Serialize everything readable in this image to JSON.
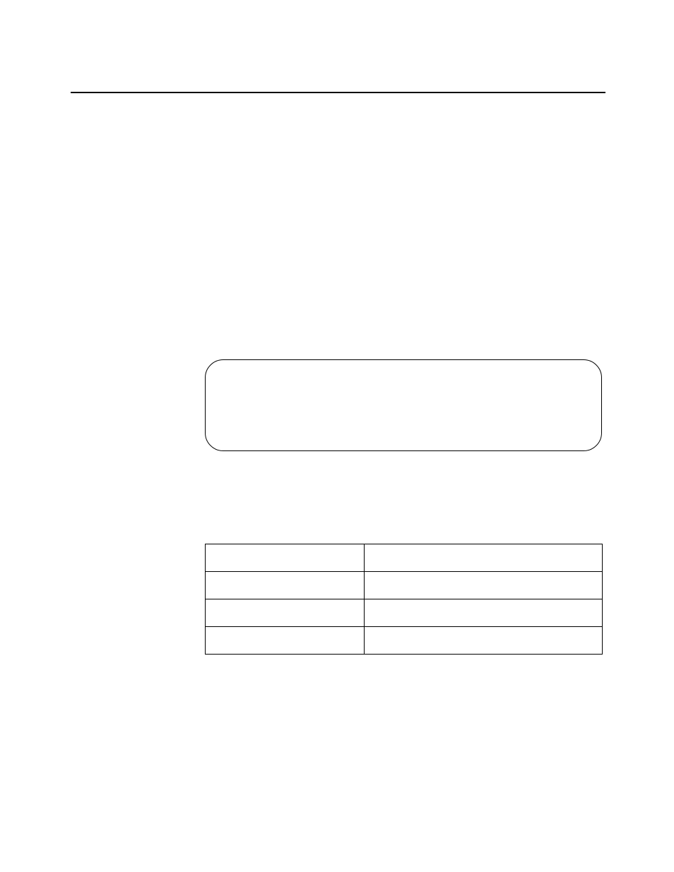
{
  "table": {
    "headers": [
      "",
      ""
    ],
    "rows": [
      [
        "",
        ""
      ],
      [
        "",
        ""
      ],
      [
        "",
        ""
      ]
    ]
  }
}
